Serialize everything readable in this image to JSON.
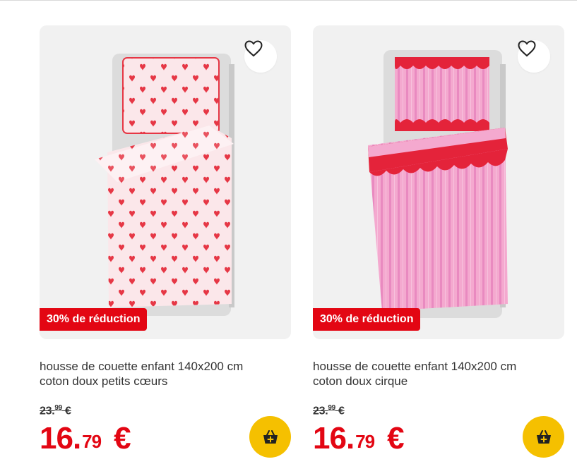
{
  "products": [
    {
      "title_line1": "housse de couette enfant 140x200 cm",
      "title_line2": "coton doux petits cœurs",
      "badge": "30% de réduction",
      "old_price_whole": "23.",
      "old_price_cents": "99",
      "old_price_currency": "€",
      "price_whole": "16.",
      "price_cents": "79",
      "price_currency": "€",
      "pattern": "hearts"
    },
    {
      "title_line1": "housse de couette enfant 140x200 cm",
      "title_line2": "coton doux cirque",
      "badge": "30% de réduction",
      "old_price_whole": "23.",
      "old_price_cents": "99",
      "old_price_currency": "€",
      "price_whole": "16.",
      "price_cents": "79",
      "price_currency": "€",
      "pattern": "stripes-scallop"
    }
  ],
  "icons": {
    "favorite": "heart-outline-icon",
    "cart": "basket-add-icon"
  },
  "colors": {
    "accent_red": "#e30613",
    "cart_yellow": "#f5c000",
    "image_bg": "#f1f1f1"
  }
}
